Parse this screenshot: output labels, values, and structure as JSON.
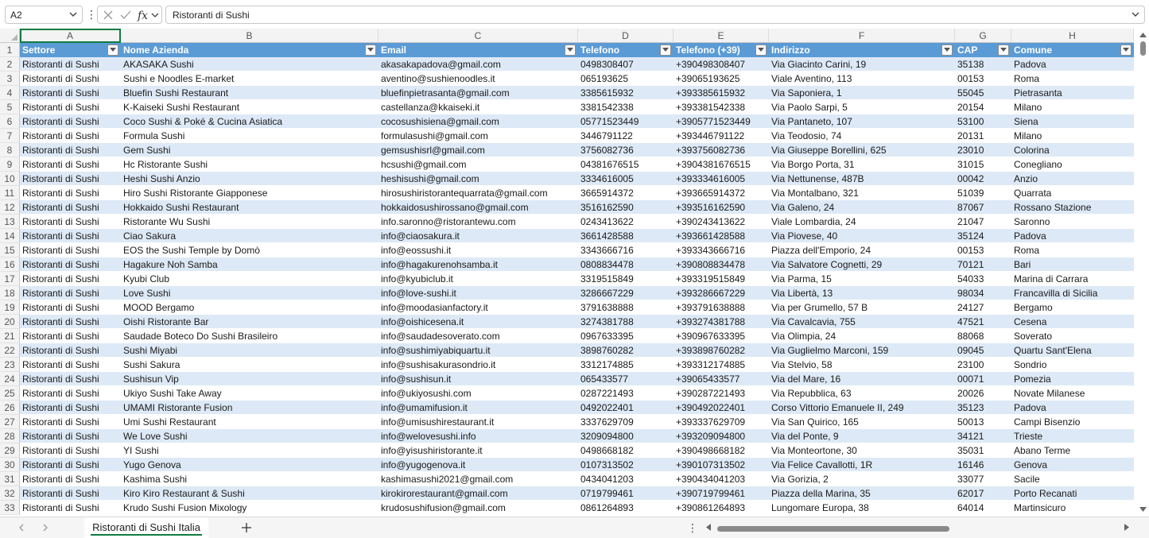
{
  "formula_bar": {
    "name_box": "A2",
    "formula": "Ristoranti di Sushi"
  },
  "columns": [
    {
      "letter": "A",
      "header": "Settore"
    },
    {
      "letter": "B",
      "header": "Nome Azienda"
    },
    {
      "letter": "C",
      "header": "Email"
    },
    {
      "letter": "D",
      "header": "Telefono"
    },
    {
      "letter": "E",
      "header": "Telefono (+39)"
    },
    {
      "letter": "F",
      "header": "Indirizzo"
    },
    {
      "letter": "G",
      "header": "CAP"
    },
    {
      "letter": "H",
      "header": "Comune"
    }
  ],
  "row_numbers": [
    "1",
    "2",
    "3",
    "4",
    "5",
    "6",
    "7",
    "8",
    "9",
    "10",
    "11",
    "12",
    "13",
    "14",
    "15",
    "16",
    "17",
    "18",
    "19",
    "20",
    "21",
    "22",
    "23",
    "24",
    "25",
    "26",
    "27",
    "28",
    "29",
    "30",
    "31",
    "32",
    "33"
  ],
  "rows": [
    [
      "Ristoranti di Sushi",
      "AKASAKA Sushi",
      "akasakapadova@gmail.com",
      "0498308407",
      "+390498308407",
      "Via Giacinto Carini, 19",
      "35138",
      "Padova"
    ],
    [
      "Ristoranti di Sushi",
      "Sushi e Noodles E-market",
      "aventino@sushienoodles.it",
      "065193625",
      "+39065193625",
      "Viale Aventino, 113",
      "00153",
      "Roma"
    ],
    [
      "Ristoranti di Sushi",
      "Bluefin Sushi Restaurant",
      "bluefinpietrasanta@gmail.com",
      "3385615932",
      "+393385615932",
      "Via Saponiera, 1",
      "55045",
      "Pietrasanta"
    ],
    [
      "Ristoranti di Sushi",
      "K-Kaiseki Sushi Restaurant",
      "castellanza@kkaiseki.it",
      "3381542338",
      "+393381542338",
      "Via Paolo Sarpi, 5",
      "20154",
      "Milano"
    ],
    [
      "Ristoranti di Sushi",
      "Coco Sushi & Poké & Cucina Asiatica",
      "cocosushisiena@gmail.com",
      "05771523449",
      "+3905771523449",
      "Via Pantaneto, 107",
      "53100",
      "Siena"
    ],
    [
      "Ristoranti di Sushi",
      "Formula Sushi",
      "formulasushi@gmail.com",
      "3446791122",
      "+393446791122",
      "Via Teodosio, 74",
      "20131",
      "Milano"
    ],
    [
      "Ristoranti di Sushi",
      "Gem Sushi",
      "gemsushisrl@gmail.com",
      "3756082736",
      "+393756082736",
      "Via Giuseppe Borellini, 625",
      "23010",
      "Colorina"
    ],
    [
      "Ristoranti di Sushi",
      "Hc Ristorante Sushi",
      "hcsushi@gmail.com",
      "04381676515",
      "+3904381676515",
      "Via Borgo Porta, 31",
      "31015",
      "Conegliano"
    ],
    [
      "Ristoranti di Sushi",
      "Heshi Sushi Anzio",
      "heshisushi@gmail.com",
      "3334616005",
      "+393334616005",
      "Via Nettunense, 487B",
      "00042",
      "Anzio"
    ],
    [
      "Ristoranti di Sushi",
      "Hiro Sushi Ristorante Giapponese",
      "hirosushiristorantequarrata@gmail.com",
      "3665914372",
      "+393665914372",
      "Via Montalbano, 321",
      "51039",
      "Quarrata"
    ],
    [
      "Ristoranti di Sushi",
      "Hokkaido Sushi Restaurant",
      "hokkaidosushirossano@gmail.com",
      "3516162590",
      "+393516162590",
      "Via Galeno, 24",
      "87067",
      "Rossano Stazione"
    ],
    [
      "Ristoranti di Sushi",
      "Ristorante Wu Sushi",
      "info.saronno@ristorantewu.com",
      "0243413622",
      "+390243413622",
      "Viale Lombardia, 24",
      "21047",
      "Saronno"
    ],
    [
      "Ristoranti di Sushi",
      "Ciao Sakura",
      "info@ciaosakura.it",
      "3661428588",
      "+393661428588",
      "Via Piovese, 40",
      "35124",
      "Padova"
    ],
    [
      "Ristoranti di Sushi",
      "EOS the Sushi Temple by Domò",
      "info@eossushi.it",
      "3343666716",
      "+393343666716",
      "Piazza dell'Emporio, 24",
      "00153",
      "Roma"
    ],
    [
      "Ristoranti di Sushi",
      "Hagakure Noh Samba",
      "info@hagakurenohsamba.it",
      "0808834478",
      "+390808834478",
      "Via Salvatore Cognetti, 29",
      "70121",
      "Bari"
    ],
    [
      "Ristoranti di Sushi",
      "Kyubi Club",
      "info@kyubiclub.it",
      "3319515849",
      "+393319515849",
      "Via Parma, 15",
      "54033",
      "Marina di Carrara"
    ],
    [
      "Ristoranti di Sushi",
      "Love Sushi",
      "info@love-sushi.it",
      "3286667229",
      "+393286667229",
      "Via Libertà, 13",
      "98034",
      "Francavilla di Sicilia"
    ],
    [
      "Ristoranti di Sushi",
      "MOOD Bergamo",
      "info@moodasianfactory.it",
      "3791638888",
      "+393791638888",
      "Via per Grumello, 57 B",
      "24127",
      "Bergamo"
    ],
    [
      "Ristoranti di Sushi",
      "Oishi Ristorante Bar",
      "info@oishicesena.it",
      "3274381788",
      "+393274381788",
      "Via Cavalcavia, 755",
      "47521",
      "Cesena"
    ],
    [
      "Ristoranti di Sushi",
      "Saudade Boteco Do Sushi Brasileiro",
      "info@saudadesoverato.com",
      "0967633395",
      "+390967633395",
      "Via Olimpia, 24",
      "88068",
      "Soverato"
    ],
    [
      "Ristoranti di Sushi",
      "Sushi Miyabi",
      "info@sushimiyabiquartu.it",
      "3898760282",
      "+393898760282",
      "Via Guglielmo Marconi, 159",
      "09045",
      "Quartu Sant'Elena"
    ],
    [
      "Ristoranti di Sushi",
      "Sushi Sakura",
      "info@sushisakurasondrio.it",
      "3312174885",
      "+393312174885",
      "Via Stelvio, 58",
      "23100",
      "Sondrio"
    ],
    [
      "Ristoranti di Sushi",
      "Sushisun Vip",
      "info@sushisun.it",
      "065433577",
      "+39065433577",
      "Via del Mare, 16",
      "00071",
      "Pomezia"
    ],
    [
      "Ristoranti di Sushi",
      "Ukiyo Sushi Take Away",
      "info@ukiyosushi.com",
      "0287221493",
      "+390287221493",
      "Via Repubblica, 63",
      "20026",
      "Novate Milanese"
    ],
    [
      "Ristoranti di Sushi",
      "UMAMI Ristorante Fusion",
      "info@umamifusion.it",
      "0492022401",
      "+390492022401",
      "Corso Vittorio Emanuele II, 249",
      "35123",
      "Padova"
    ],
    [
      "Ristoranti di Sushi",
      "Umi Sushi Restaurant",
      "info@umisushirestaurant.it",
      "3337629709",
      "+393337629709",
      "Via San Quirico, 165",
      "50013",
      "Campi Bisenzio"
    ],
    [
      "Ristoranti di Sushi",
      "We Love Sushi",
      "info@welovesushi.info",
      "3209094800",
      "+393209094800",
      "Via del Ponte, 9",
      "34121",
      "Trieste"
    ],
    [
      "Ristoranti di Sushi",
      "YI Sushi",
      "info@yisushiristorante.it",
      "0498668182",
      "+390498668182",
      "Via Monteortone, 30",
      "35031",
      "Abano Terme"
    ],
    [
      "Ristoranti di Sushi",
      "Yugo Genova",
      "info@yugogenova.it",
      "0107313502",
      "+390107313502",
      "Via Felice Cavallotti, 1R",
      "16146",
      "Genova"
    ],
    [
      "Ristoranti di Sushi",
      "Kashima Sushi",
      "kashimasushi2021@gmail.com",
      "0434041203",
      "+390434041203",
      "Via Gorizia, 2",
      "33077",
      "Sacile"
    ],
    [
      "Ristoranti di Sushi",
      "Kiro Kiro Restaurant & Sushi",
      "kirokirorestaurant@gmail.com",
      "0719799461",
      "+390719799461",
      "Piazza della Marina, 35",
      "62017",
      "Porto Recanati"
    ],
    [
      "Ristoranti di Sushi",
      "Krudo Sushi Fusion Mixology",
      "krudosushifusion@gmail.com",
      "0861264893",
      "+390861264893",
      "Lungomare Europa, 38",
      "64014",
      "Martinsicuro"
    ]
  ],
  "sheet_tabs": [
    {
      "label": "Ristoranti di Sushi Italia",
      "active": true
    }
  ],
  "colors": {
    "header_fill": "#5b9bd5",
    "band_fill": "#dde9f6",
    "accent": "#107c41"
  }
}
